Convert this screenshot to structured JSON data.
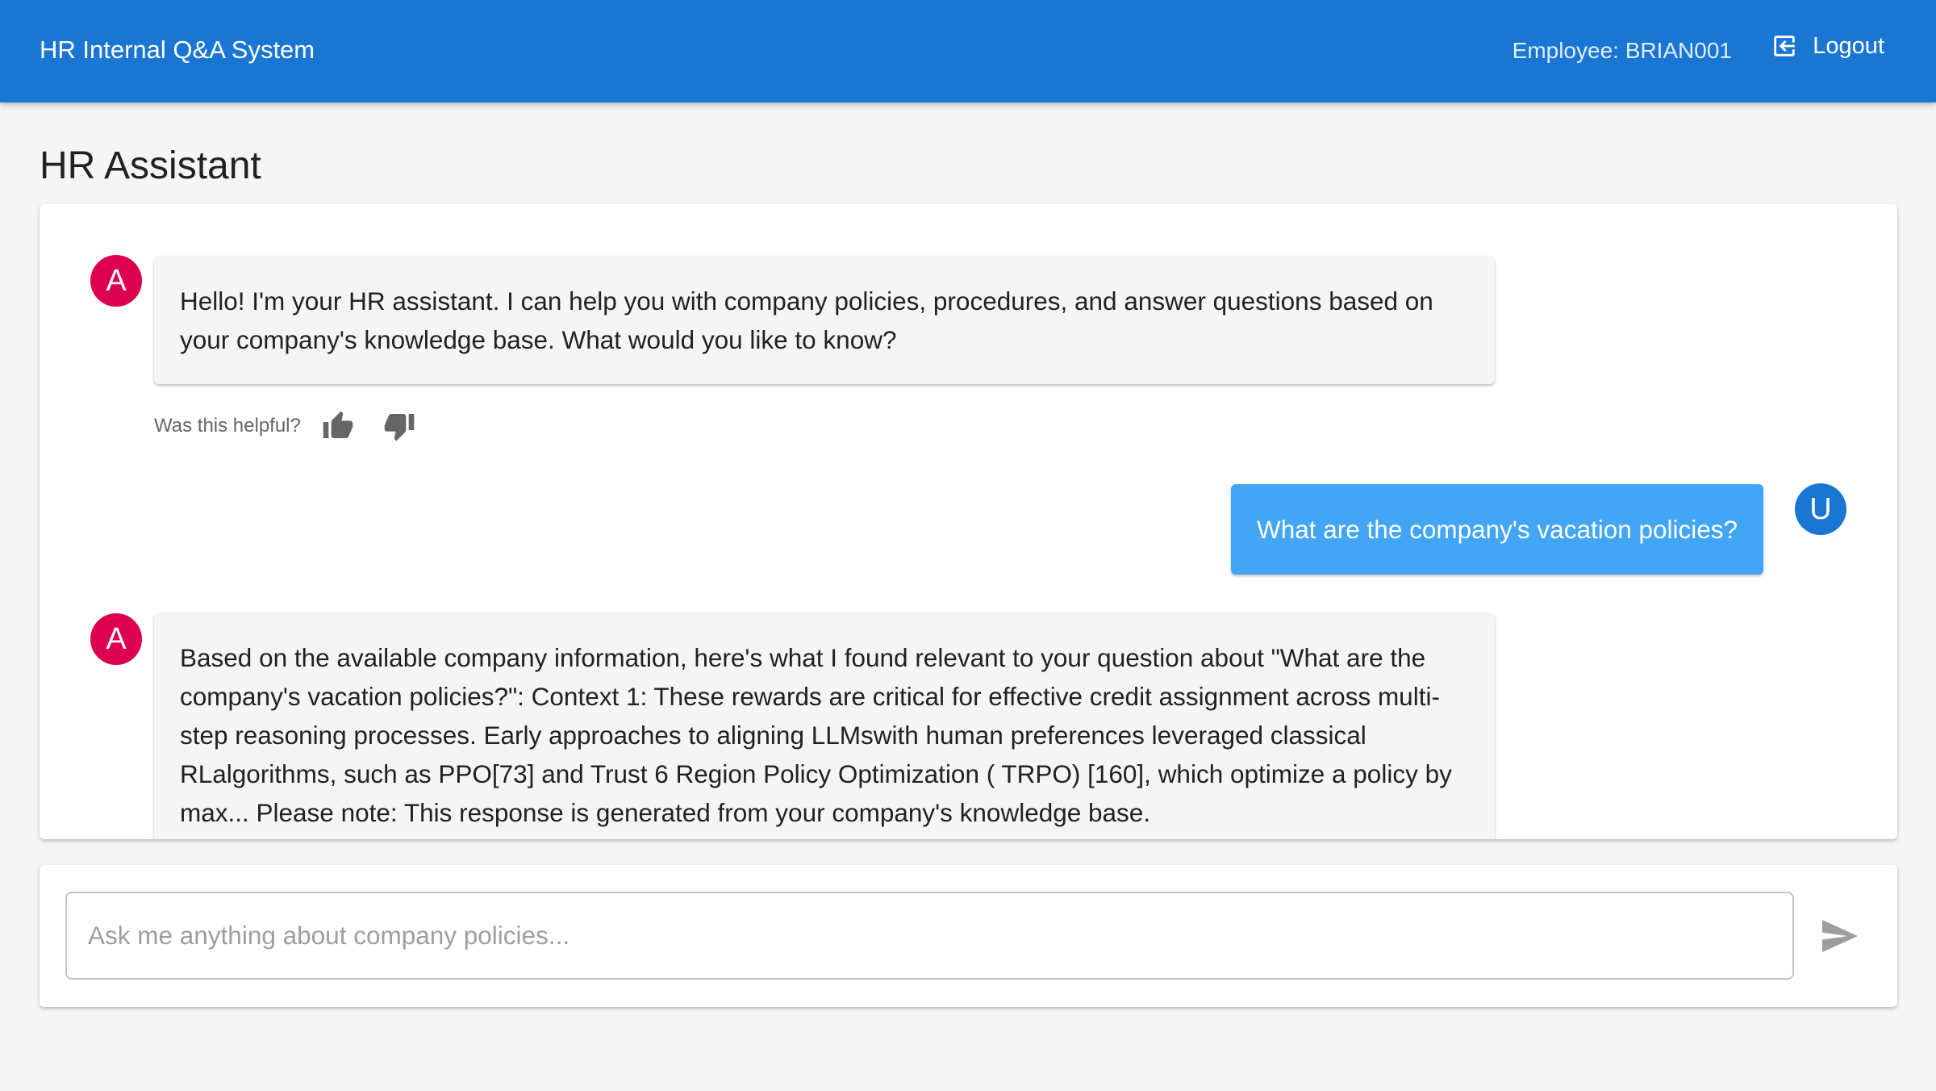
{
  "header": {
    "title": "HR Internal Q&A System",
    "employee": "Employee: BRIAN001",
    "logout_label": "Logout"
  },
  "page": {
    "title": "HR Assistant"
  },
  "colors": {
    "primary": "#1976d2",
    "assistant_avatar": "#dc004e",
    "user_bubble": "#42a5f5"
  },
  "messages": [
    {
      "role": "assistant",
      "avatar": "A",
      "text": "Hello! I'm your HR assistant. I can help you with company policies, procedures, and answer questions based on your company's knowledge base. What would you like to know?",
      "feedback_prompt": "Was this helpful?"
    },
    {
      "role": "user",
      "avatar": "U",
      "text": "What are the company's vacation policies?"
    },
    {
      "role": "assistant",
      "avatar": "A",
      "text": "Based on the available company information, here's what I found relevant to your question about \"What are the company's vacation policies?\": Context 1: These rewards are critical for effective credit assignment across multi- step reasoning processes. Early approaches to aligning LLMswith human preferences leveraged classical RLalgorithms, such as PPO[73] and Trust 6 Region Policy Optimization ( TRPO) [160], which optimize a policy by max... Please note: This response is generated from your company's knowledge base."
    }
  ],
  "input": {
    "placeholder": "Ask me anything about company policies...",
    "value": ""
  },
  "icons": {
    "logout": "logout-icon",
    "thumb_up": "thumb-up-icon",
    "thumb_down": "thumb-down-icon",
    "send": "send-icon"
  }
}
